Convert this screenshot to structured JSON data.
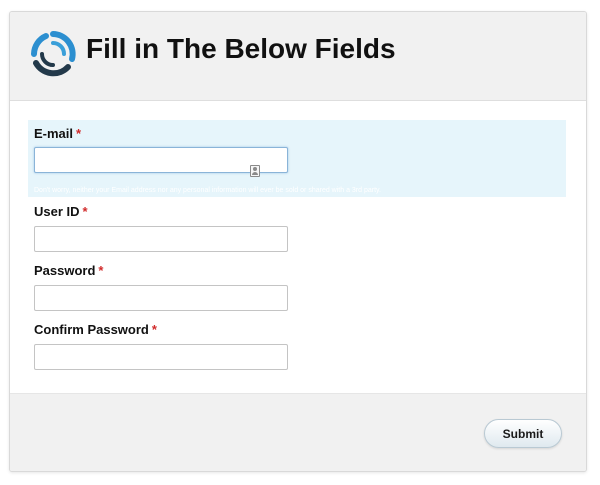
{
  "form": {
    "title": "Fill in The Below Fields",
    "required_marker": "*",
    "fields": {
      "email": {
        "label": "E-mail",
        "value": "",
        "hint": "Don't worry, neither your Email address nor any personal information will ever be sold or shared with a 3rd party."
      },
      "user_id": {
        "label": "User ID",
        "value": ""
      },
      "password": {
        "label": "Password",
        "value": ""
      },
      "confirm_password": {
        "label": "Confirm Password",
        "value": ""
      }
    },
    "submit_label": "Submit"
  },
  "colors": {
    "email_highlight": "#e6f5fb",
    "required": "#d12b2b",
    "logo_blue": "#2c8fd0",
    "logo_dark": "#23394a"
  },
  "icons": {
    "logo": "swirl-logo-icon",
    "autofill": "contact-card-icon"
  }
}
